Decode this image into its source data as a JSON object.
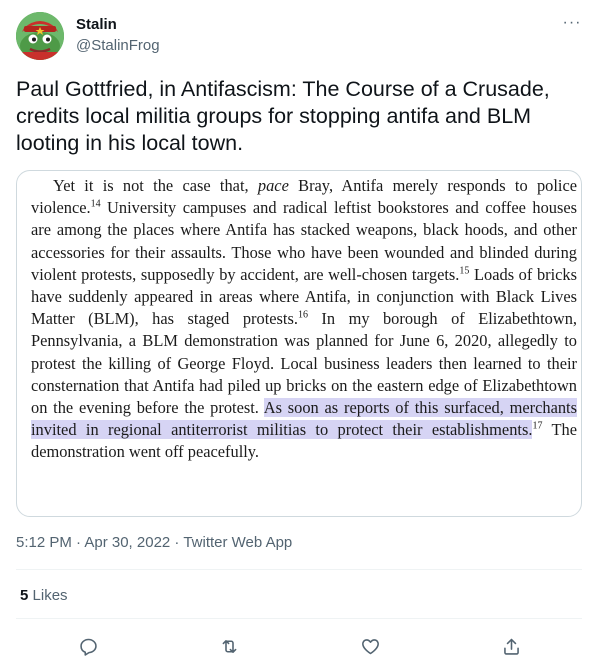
{
  "author": {
    "display_name": "Stalin",
    "handle": "@StalinFrog",
    "more_label": "···"
  },
  "tweet": {
    "text": "Paul Gottfried, in Antifascism: The Course of a Crusade,  credits local militia groups for stopping antifa and BLM looting in his local town."
  },
  "media": {
    "part1": "Yet it is not the case that, ",
    "part1_italic": "pace",
    "part2": " Bray, Antifa merely responds to police violence.",
    "fn14": "14",
    "part3": " University campuses and radical leftist bookstores and coffee houses are among the places where Antifa has stacked weapons, black hoods, and other accessories for their assaults. Those who have been wounded and blinded during violent protests, supposedly by accident, are well-chosen targets.",
    "fn15": "15",
    "part4": " Loads of bricks have suddenly appeared in areas where Antifa, in conjunction with Black Lives Matter (BLM), has staged protests.",
    "fn16": "16",
    "part5": " In my borough of Elizabethtown, Pennsylvania, a BLM demonstration was planned for June 6, 2020, allegedly to protest the killing of George Floyd. Local business leaders then learned to their consternation that Antifa had piled up bricks on the eastern edge of Elizabethtown on the evening before the protest. ",
    "highlight": "As soon as reports of this surfaced, merchants invited in regional antiterrorist militias to protect their establishments.",
    "fn17": "17",
    "part6": " The demonstration went off peacefully.",
    "highlight_color": "#d6d4f4"
  },
  "meta": {
    "timestamp": "5:12 PM · Apr 30, 2022 · Twitter Web App"
  },
  "stats": {
    "likes_count": "5",
    "likes_label": "Likes"
  },
  "actions": [
    "reply-icon",
    "retweet-icon",
    "like-icon",
    "share-icon"
  ],
  "colors": {
    "text": "#0f1419",
    "secondary": "#536471",
    "border": "#cfd9de"
  }
}
